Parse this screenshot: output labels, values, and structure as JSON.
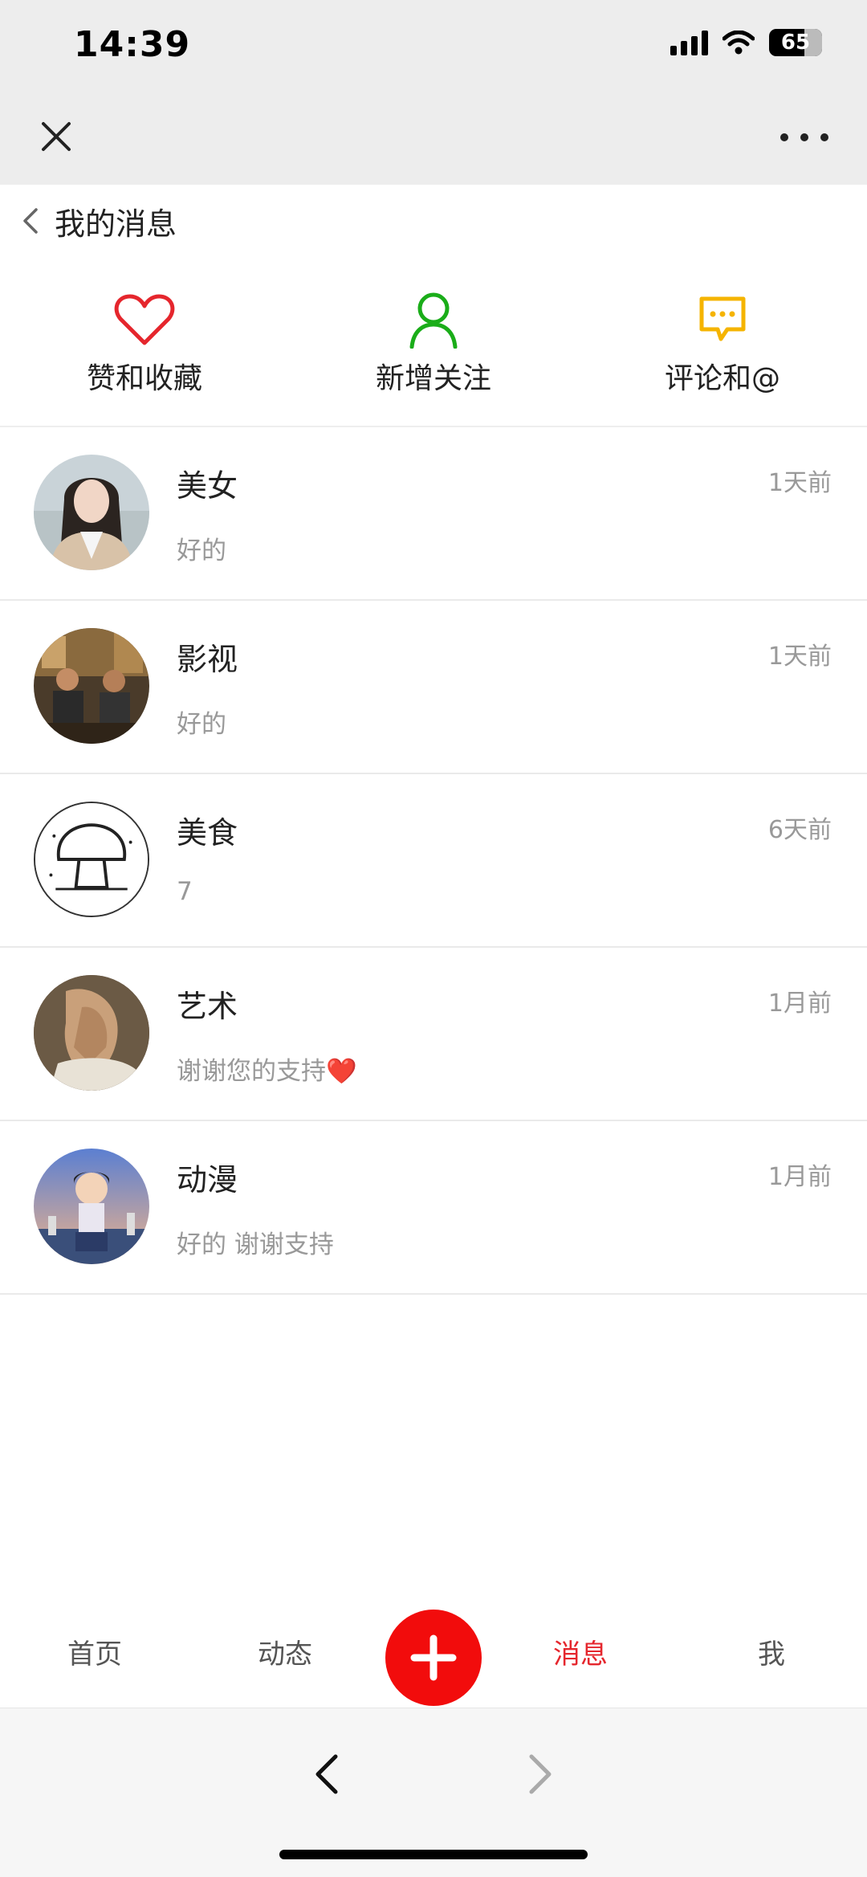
{
  "status_bar": {
    "time": "14:39",
    "battery": "65"
  },
  "header": {
    "title": "我的消息"
  },
  "categories": [
    {
      "label": "赞和收藏",
      "icon": "heart-icon",
      "color": "#e5262d"
    },
    {
      "label": "新增关注",
      "icon": "person-icon",
      "color": "#1aad19"
    },
    {
      "label": "评论和@",
      "icon": "comment-icon",
      "color": "#f5b400"
    }
  ],
  "messages": [
    {
      "name": "美女",
      "preview": "好的",
      "time": "1天前",
      "avatar": "woman-portrait-avatar"
    },
    {
      "name": "影视",
      "preview": "好的",
      "time": "1天前",
      "avatar": "film-scene-avatar"
    },
    {
      "name": "美食",
      "preview": "7",
      "time": "6天前",
      "avatar": "mushroom-sketch-avatar"
    },
    {
      "name": "艺术",
      "preview": "谢谢您的支持❤️",
      "time": "1月前",
      "avatar": "classical-painting-avatar"
    },
    {
      "name": "动漫",
      "preview": "好的 谢谢支持",
      "time": "1月前",
      "avatar": "anime-boy-avatar"
    }
  ],
  "tabbar": {
    "home": "首页",
    "feed": "动态",
    "messages": "消息",
    "me": "我",
    "active_color": "#e5262d",
    "plus_color": "#f20c0c"
  }
}
